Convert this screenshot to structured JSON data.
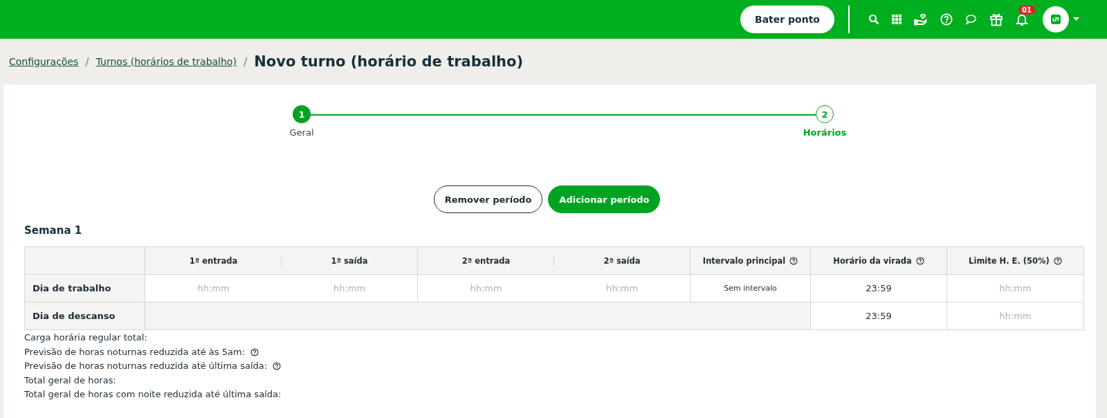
{
  "header": {
    "clock_button": "Bater ponto",
    "notification_badge": "01"
  },
  "breadcrumb": {
    "links": [
      {
        "label": "Configurações",
        "separator": "/"
      },
      {
        "label": "Turnos (horários de trabalho)",
        "separator": "/"
      }
    ],
    "current": "Novo turno (horário de trabalho)"
  },
  "stepper": {
    "steps": [
      {
        "number": "1",
        "label": "Geral",
        "done": true,
        "active": false
      },
      {
        "number": "2",
        "label": "Horários",
        "done": false,
        "active": true
      }
    ]
  },
  "actions": [
    {
      "label": "Remover período",
      "kind": "outline"
    },
    {
      "label": "Adicionar período",
      "kind": "primary"
    }
  ],
  "week": {
    "title": "Semana 1",
    "table": {
      "columns": [
        {
          "label": "1ª entrada",
          "kind": "plain"
        },
        {
          "label": "1ª saída",
          "kind": "plain"
        },
        {
          "label": "2ª entrada",
          "kind": "plain"
        },
        {
          "label": "2ª saída",
          "kind": "plain"
        },
        {
          "label": "Intervalo principal",
          "kind": "with_help"
        },
        {
          "label": "Horário da virada",
          "kind": "with_help"
        },
        {
          "label": "Limite H. E. (50%)",
          "kind": "with_help"
        }
      ],
      "rows": [
        {
          "label": "Dia de trabalho",
          "kind": "work",
          "cells": [
            {
              "kind": "input",
              "placeholder": "hh:mm"
            },
            {
              "kind": "input",
              "placeholder": "hh:mm"
            },
            {
              "kind": "input",
              "placeholder": "hh:mm"
            },
            {
              "kind": "input",
              "placeholder": "hh:mm"
            },
            {
              "kind": "small",
              "text": "Sem intervalo"
            },
            {
              "kind": "text",
              "text": "23:59"
            },
            {
              "kind": "input",
              "placeholder": "hh:mm"
            }
          ]
        },
        {
          "label": "Dia de descanso",
          "kind": "rest",
          "cells": [
            "",
            "",
            "",
            "",
            "",
            {
              "kind": "text",
              "text": "23:59"
            },
            {
              "kind": "input",
              "placeholder": "hh:mm"
            }
          ]
        }
      ]
    }
  },
  "summary": [
    {
      "text": "Carga horária regular total:",
      "kind": "plain"
    },
    {
      "text": "Previsão de horas noturnas reduzida até às 5am:",
      "kind": "with_help"
    },
    {
      "text": "Previsão de horas noturnas reduzida até última saída:",
      "kind": "with_help"
    },
    {
      "text": "Total geral de horas:",
      "kind": "plain"
    },
    {
      "text": "Total geral de horas com noite reduzida até última saída:",
      "kind": "plain"
    }
  ]
}
